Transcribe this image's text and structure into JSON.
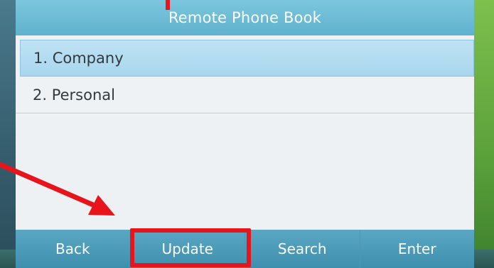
{
  "screen": {
    "title": "Remote Phone Book",
    "items": [
      {
        "label": "1. Company",
        "selected": true
      },
      {
        "label": "2. Personal",
        "selected": false
      }
    ]
  },
  "softkeys": [
    {
      "label": "Back"
    },
    {
      "label": "Update"
    },
    {
      "label": "Search"
    },
    {
      "label": "Enter"
    }
  ],
  "colors": {
    "title_bar": "#6bbcd6",
    "selection": "#b4dcf0",
    "softkey_bar": "#4a9ab9",
    "annotation": "#e8141b"
  }
}
